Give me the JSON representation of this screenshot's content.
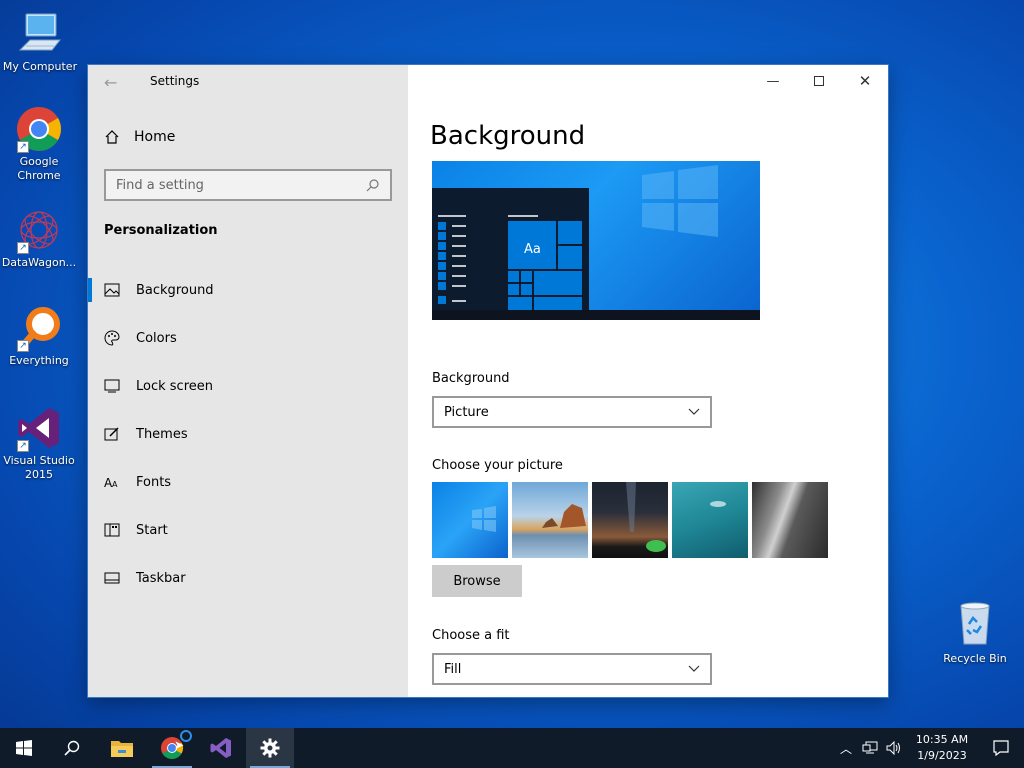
{
  "desktop": {
    "icons": [
      {
        "label": "My Computer"
      },
      {
        "label": "Google Chrome"
      },
      {
        "label": "DataWagon..."
      },
      {
        "label": "Everything"
      },
      {
        "label": "Visual Studio 2015"
      }
    ],
    "recycle_bin": "Recycle Bin"
  },
  "window": {
    "title": "Settings",
    "nav": {
      "home": "Home",
      "search_placeholder": "Find a setting",
      "section": "Personalization",
      "items": [
        {
          "label": "Background",
          "icon": "picture-icon"
        },
        {
          "label": "Colors",
          "icon": "palette-icon"
        },
        {
          "label": "Lock screen",
          "icon": "lock-screen-icon"
        },
        {
          "label": "Themes",
          "icon": "themes-icon"
        },
        {
          "label": "Fonts",
          "icon": "fonts-icon"
        },
        {
          "label": "Start",
          "icon": "start-icon"
        },
        {
          "label": "Taskbar",
          "icon": "taskbar-icon"
        }
      ]
    },
    "content": {
      "title": "Background",
      "preview_sample_text": "Aa",
      "background_label": "Background",
      "background_value": "Picture",
      "choose_picture_label": "Choose your picture",
      "browse_label": "Browse",
      "fit_label": "Choose a fit",
      "fit_value": "Fill"
    }
  },
  "taskbar": {
    "time": "10:35 AM",
    "date": "1/9/2023"
  },
  "colors": {
    "accent": "#0078d7",
    "nav_bg": "#e6e6e6",
    "taskbar_bg": "#101b2a"
  }
}
